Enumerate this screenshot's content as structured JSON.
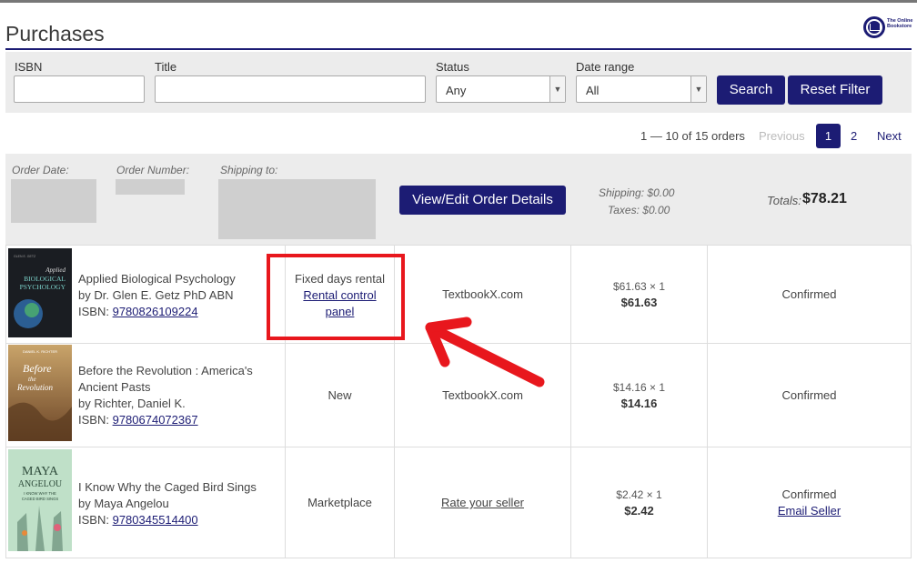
{
  "page": {
    "title": "Purchases",
    "logo_text": "The Online Bookstore"
  },
  "filters": {
    "isbn_label": "ISBN",
    "isbn_value": "",
    "title_label": "Title",
    "title_value": "",
    "status_label": "Status",
    "status_value": "Any",
    "date_label": "Date range",
    "date_value": "All",
    "search_label": "Search",
    "reset_label": "Reset Filter"
  },
  "pagination": {
    "summary": "1 — 10 of 15 orders",
    "previous": "Previous",
    "pages": [
      "1",
      "2"
    ],
    "next": "Next"
  },
  "order": {
    "date_label": "Order Date:",
    "number_label": "Order Number:",
    "shipping_to_label": "Shipping to:",
    "view_button": "View/Edit Order Details",
    "shipping_label": "Shipping:",
    "shipping_value": "$0.00",
    "taxes_label": "Taxes:",
    "taxes_value": "$0.00",
    "totals_label": "Totals:",
    "totals_value": "$78.21"
  },
  "items": [
    {
      "title": "Applied Biological Psychology",
      "author": "by Dr. Glen E. Getz PhD ABN",
      "isbn_prefix": "ISBN:",
      "isbn": "9780826109224",
      "condition": "Fixed days rental",
      "condition_link": "Rental control panel",
      "seller": "TextbookX.com",
      "unit_price": "$61.63 × 1",
      "line_total": "$61.63",
      "status": "Confirmed"
    },
    {
      "title": "Before the Revolution : America's Ancient Pasts",
      "author": "by Richter, Daniel K.",
      "isbn_prefix": "ISBN:",
      "isbn": "9780674072367",
      "condition": "New",
      "seller": "TextbookX.com",
      "unit_price": "$14.16 × 1",
      "line_total": "$14.16",
      "status": "Confirmed"
    },
    {
      "title": "I Know Why the Caged Bird Sings",
      "author": "by Maya Angelou",
      "isbn_prefix": "ISBN:",
      "isbn": "9780345514400",
      "condition": "Marketplace",
      "seller_link": "Rate your seller",
      "unit_price": "$2.42 × 1",
      "line_total": "$2.42",
      "status": "Confirmed",
      "status_link": "Email Seller"
    }
  ],
  "covers": [
    {
      "lines": [
        "Applied",
        "BIOLOGICAL",
        "PSYCHOLOGY"
      ],
      "author_line": "GLEN E. GETZ"
    },
    {
      "lines": [
        "Before",
        "the",
        "Revolution"
      ],
      "author_line": "DANIEL K. RICHTER"
    },
    {
      "lines": [
        "MAYA",
        "ANGELOU"
      ],
      "sub_lines": [
        "I KNOW WHY THE",
        "CAGED BIRD SINGS"
      ]
    }
  ],
  "colors": {
    "brand": "#1c1c74",
    "highlight": "#e8171d",
    "panel": "#ececec"
  },
  "icons": [
    "logo-icon",
    "chevron-down-icon",
    "arrow-annotation-icon"
  ]
}
